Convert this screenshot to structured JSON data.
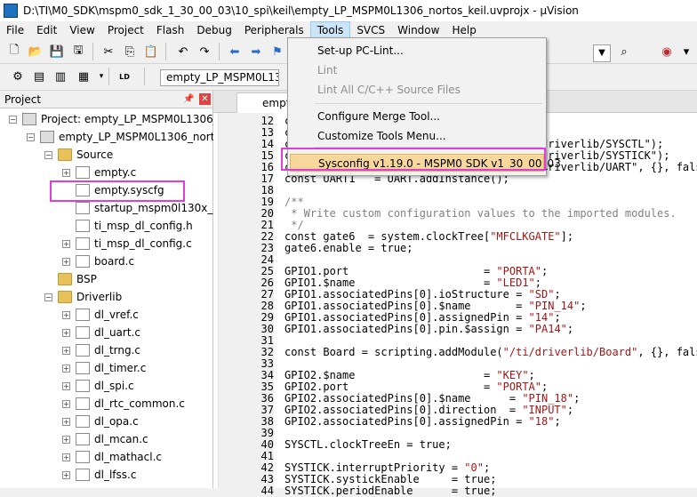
{
  "window": {
    "title": "D:\\TI\\M0_SDK\\mspm0_sdk_1_30_00_03\\10_spi\\keil\\empty_LP_MSPM0L1306_nortos_keil.uvprojx - µVision"
  },
  "menu": [
    "File",
    "Edit",
    "View",
    "Project",
    "Flash",
    "Debug",
    "Peripherals",
    "Tools",
    "SVCS",
    "Window",
    "Help"
  ],
  "toolbar": {
    "target_combo": "empty_LP_MSPM0L1306_n"
  },
  "project_panel": {
    "title": "Project",
    "tree": [
      {
        "label": "Project: empty_LP_MSPM0L1306_no",
        "level": 0,
        "type": "proj",
        "expander": "−"
      },
      {
        "label": "empty_LP_MSPM0L1306_nortos_",
        "level": 1,
        "type": "proj",
        "expander": "−"
      },
      {
        "label": "Source",
        "level": 2,
        "type": "folder",
        "expander": "−"
      },
      {
        "label": "empty.c",
        "level": 3,
        "type": "file",
        "expander": "+"
      },
      {
        "label": "empty.syscfg",
        "level": 3,
        "type": "file",
        "expander": ""
      },
      {
        "label": "startup_mspm0l130x_uvi",
        "level": 3,
        "type": "file",
        "expander": ""
      },
      {
        "label": "ti_msp_dl_config.h",
        "level": 3,
        "type": "file",
        "expander": ""
      },
      {
        "label": "ti_msp_dl_config.c",
        "level": 3,
        "type": "file",
        "expander": "+"
      },
      {
        "label": "board.c",
        "level": 3,
        "type": "file",
        "expander": "+"
      },
      {
        "label": "BSP",
        "level": 2,
        "type": "folder",
        "expander": ""
      },
      {
        "label": "Driverlib",
        "level": 2,
        "type": "folder",
        "expander": "−"
      },
      {
        "label": "dl_vref.c",
        "level": 3,
        "type": "file",
        "expander": "+"
      },
      {
        "label": "dl_uart.c",
        "level": 3,
        "type": "file",
        "expander": "+"
      },
      {
        "label": "dl_trng.c",
        "level": 3,
        "type": "file",
        "expander": "+"
      },
      {
        "label": "dl_timer.c",
        "level": 3,
        "type": "file",
        "expander": "+"
      },
      {
        "label": "dl_spi.c",
        "level": 3,
        "type": "file",
        "expander": "+"
      },
      {
        "label": "dl_rtc_common.c",
        "level": 3,
        "type": "file",
        "expander": "+"
      },
      {
        "label": "dl_opa.c",
        "level": 3,
        "type": "file",
        "expander": "+"
      },
      {
        "label": "dl_mcan.c",
        "level": 3,
        "type": "file",
        "expander": "+"
      },
      {
        "label": "dl_mathacl.c",
        "level": 3,
        "type": "file",
        "expander": "+"
      },
      {
        "label": "dl_lfss.c",
        "level": 3,
        "type": "file",
        "expander": "+"
      }
    ]
  },
  "editor": {
    "tab_label": "empty",
    "lines": [
      {
        "n": "12",
        "t": "c"
      },
      {
        "n": "13",
        "t": "c"
      },
      {
        "n": "14",
        "t": "c                                       driverlib/SYSCTL\");"
      },
      {
        "n": "15",
        "t": "c                                       driverlib/SYSTICK\");"
      },
      {
        "n": "16",
        "t": "c                                       driverlib/UART\", {}, fals"
      },
      {
        "n": "17",
        "t": "const UART1   = UART.addInstance();"
      },
      {
        "n": "18",
        "t": ""
      },
      {
        "n": "19",
        "t": "/**"
      },
      {
        "n": "20",
        "t": " * Write custom configuration values to the imported modules."
      },
      {
        "n": "21",
        "t": " */"
      },
      {
        "n": "22",
        "t": "const gate6  = system.clockTree[\"MFCLKGATE\"];"
      },
      {
        "n": "23",
        "t": "gate6.enable = true;"
      },
      {
        "n": "24",
        "t": ""
      },
      {
        "n": "25",
        "t": "GPIO1.port                     = \"PORTA\";"
      },
      {
        "n": "26",
        "t": "GPIO1.$name                    = \"LED1\";"
      },
      {
        "n": "27",
        "t": "GPIO1.associatedPins[0].ioStructure = \"SD\";"
      },
      {
        "n": "28",
        "t": "GPIO1.associatedPins[0].$name       = \"PIN_14\";"
      },
      {
        "n": "29",
        "t": "GPIO1.associatedPins[0].assignedPin = \"14\";"
      },
      {
        "n": "30",
        "t": "GPIO1.associatedPins[0].pin.$assign = \"PA14\";"
      },
      {
        "n": "31",
        "t": ""
      },
      {
        "n": "32",
        "t": "const Board = scripting.addModule(\"/ti/driverlib/Board\", {}, false"
      },
      {
        "n": "33",
        "t": ""
      },
      {
        "n": "34",
        "t": "GPIO2.$name                    = \"KEY\";"
      },
      {
        "n": "35",
        "t": "GPIO2.port                     = \"PORTA\";"
      },
      {
        "n": "36",
        "t": "GPIO2.associatedPins[0].$name      = \"PIN_18\";"
      },
      {
        "n": "37",
        "t": "GPIO2.associatedPins[0].direction  = \"INPUT\";"
      },
      {
        "n": "38",
        "t": "GPIO2.associatedPins[0].assignedPin = \"18\";"
      },
      {
        "n": "39",
        "t": ""
      },
      {
        "n": "40",
        "t": "SYSCTL.clockTreeEn = true;"
      },
      {
        "n": "41",
        "t": ""
      },
      {
        "n": "42",
        "t": "SYSTICK.interruptPriority = \"0\";"
      },
      {
        "n": "43",
        "t": "SYSTICK.systickEnable     = true;"
      },
      {
        "n": "44",
        "t": "SYSTICK.periodEnable      = true;"
      }
    ]
  },
  "tools_menu": {
    "items": [
      {
        "label": "Set-up PC-Lint...",
        "disabled": false,
        "selected": false
      },
      {
        "label": "Lint",
        "disabled": true,
        "selected": false
      },
      {
        "label": "Lint All C/C++ Source Files",
        "disabled": true,
        "selected": false
      },
      {
        "label": "Configure Merge Tool...",
        "disabled": false,
        "selected": false
      },
      {
        "label": "Customize Tools Menu...",
        "disabled": false,
        "selected": false
      },
      {
        "label": "Sysconfig v1.19.0 - MSPM0 SDK v1_30_00_03",
        "disabled": false,
        "selected": true
      }
    ]
  },
  "colors": {
    "highlight": "#e23cde",
    "menu_selected": "#f7d79c"
  }
}
